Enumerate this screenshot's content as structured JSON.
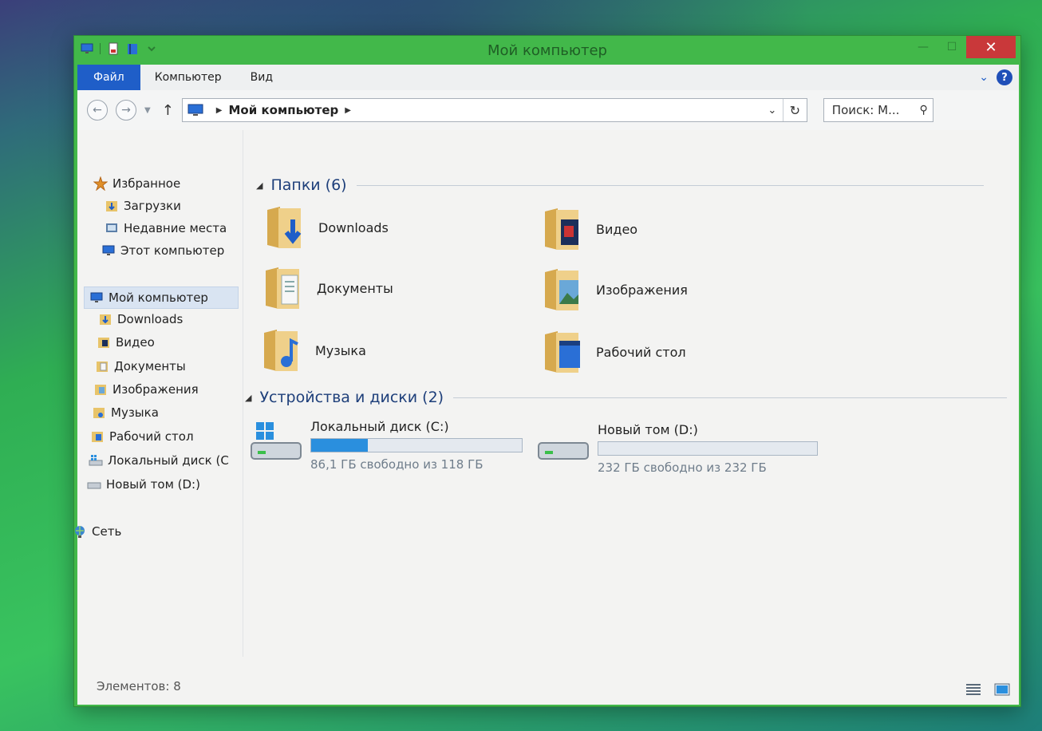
{
  "window": {
    "title": "Мой компьютер",
    "close_glyph": "✕",
    "minimize_glyph": "—",
    "maximize_glyph": "☐"
  },
  "ribbon": {
    "tabs": [
      "Файл",
      "Компьютер",
      "Вид"
    ]
  },
  "navigation": {
    "back_glyph": "←",
    "forward_glyph": "→",
    "up_glyph": "↑",
    "breadcrumb": "Мой компьютер",
    "search_placeholder": "Поиск: М..."
  },
  "sidebar": {
    "favorites": [
      "Избранное",
      "Загрузки",
      "Недавние места",
      "Этот компьютер"
    ],
    "computer": "Мой компьютер",
    "computer_items": [
      "Downloads",
      "Видео",
      "Документы",
      "Изображения",
      "Музыка",
      "Рабочий стол",
      "Локальный диск (С",
      "Новый том (D:)"
    ],
    "network": "Сеть"
  },
  "folders_group": {
    "title": "Папки (6)",
    "items": [
      "Downloads",
      "Видео",
      "Документы",
      "Изображения",
      "Музыка",
      "Рабочий стол"
    ]
  },
  "drives_group": {
    "title": "Устройства и диски (2)",
    "drives": [
      {
        "name": "Локальный диск (C:)",
        "free_text": "86,1 ГБ свободно из 118 ГБ",
        "used_fraction": 0.27
      },
      {
        "name": "Новый том (D:)",
        "free_text": "232 ГБ свободно из 232 ГБ",
        "used_fraction": 0.0
      }
    ]
  },
  "status": {
    "text": "Элементов: 8"
  },
  "colors": {
    "window_frame": "#42b84a",
    "file_tab": "#1f5ec8",
    "close_button": "#c9383a",
    "usage_bar": "#2a8fde"
  }
}
